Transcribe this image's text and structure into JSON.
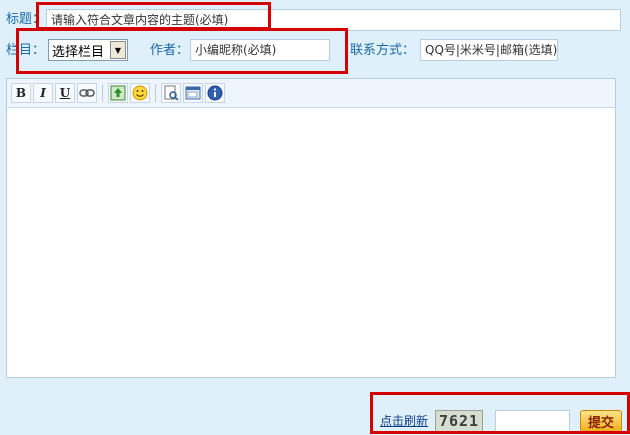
{
  "form": {
    "title_label": "标题：",
    "title_placeholder": "请输入符合文章内容的主题(必填)",
    "column_label": "栏目：",
    "column_selected": "选择栏目",
    "author_label": "作者：",
    "author_placeholder": "小编昵称(必填)",
    "contact_label": "联系方式：",
    "contact_placeholder": "QQ号|米米号|邮箱(选填)"
  },
  "toolbar": {
    "bold": "B",
    "italic": "I",
    "underline": "U"
  },
  "footer": {
    "refresh_link": "点击刷新",
    "captcha_text": "7621",
    "captcha_input_value": "",
    "submit_label": "提交"
  },
  "colors": {
    "background": "#dff0fb",
    "highlight_box": "#d40000"
  },
  "icons": [
    "link-icon",
    "image-icon",
    "smiley-icon",
    "preview-icon",
    "source-icon",
    "info-icon"
  ]
}
